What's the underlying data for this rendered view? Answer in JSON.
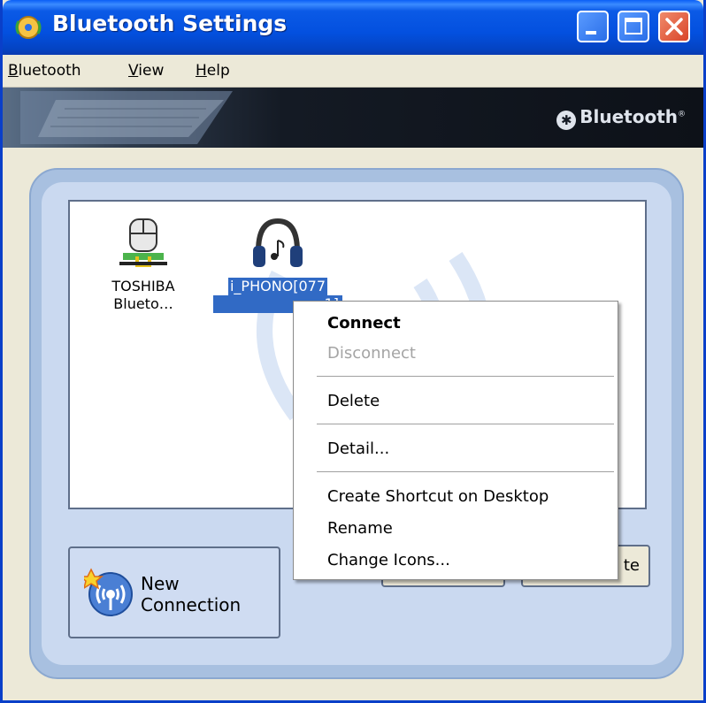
{
  "window": {
    "title": "Bluetooth Settings"
  },
  "menubar": {
    "bluetooth": {
      "accel": "B",
      "rest": "luetooth"
    },
    "view": {
      "accel": "V",
      "rest": "iew"
    },
    "help": {
      "accel": "H",
      "rest": "elp"
    }
  },
  "banner": {
    "brand": "Bluetooth",
    "brand_mark": "®"
  },
  "devices": [
    {
      "line1": "TOSHIBA",
      "line2": "Blueto…",
      "icon": "mouse-icon",
      "selected": false
    },
    {
      "line1": "i_PHONO[077",
      "line2": "1]",
      "icon": "headphones-icon",
      "selected": true
    }
  ],
  "buttons": {
    "new_connection_line1": "New",
    "new_connection_line2": "Connection",
    "partial_right": "te"
  },
  "context_menu": {
    "items": [
      {
        "label": "Connect",
        "style": "bold"
      },
      {
        "label": "Disconnect",
        "style": "disabled"
      },
      {
        "label": "Delete",
        "style": "normal"
      },
      {
        "label": "Detail...",
        "style": "normal"
      },
      {
        "label": "Create Shortcut on Desktop",
        "style": "normal"
      },
      {
        "label": "Rename",
        "style": "normal"
      },
      {
        "label": "Change Icons...",
        "style": "normal"
      }
    ]
  },
  "colors": {
    "titlebar": "#0350df",
    "selection": "#316ac5",
    "panel": "#a8c0e0",
    "close_button": "#d9452a"
  }
}
